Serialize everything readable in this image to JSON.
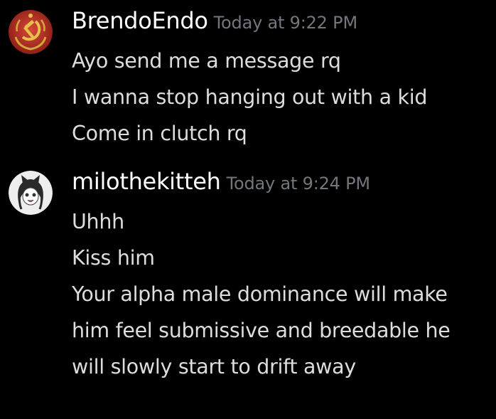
{
  "messages": [
    {
      "username": "BrendoEndo",
      "timestamp": "Today at 9:22 PM",
      "avatar_icon": "hammer-sickle-avatar",
      "lines": [
        "Ayo send me a message rq",
        "I wanna stop hanging out with a kid",
        "Come in clutch rq"
      ]
    },
    {
      "username": "milothekitteh",
      "timestamp": "Today at 9:24 PM",
      "avatar_icon": "anime-cat-girl-avatar",
      "lines": [
        "Uhhh",
        "Kiss him",
        "Your alpha male dominance will make",
        "him feel submissive and breedable he",
        "will slowly start to drift away"
      ]
    }
  ],
  "colors": {
    "background": "#000000",
    "username": "#ffffff",
    "timestamp": "#72767d",
    "message_text": "#dcddde",
    "avatar1_red": "#c0392b",
    "avatar1_gold": "#e0b341"
  }
}
